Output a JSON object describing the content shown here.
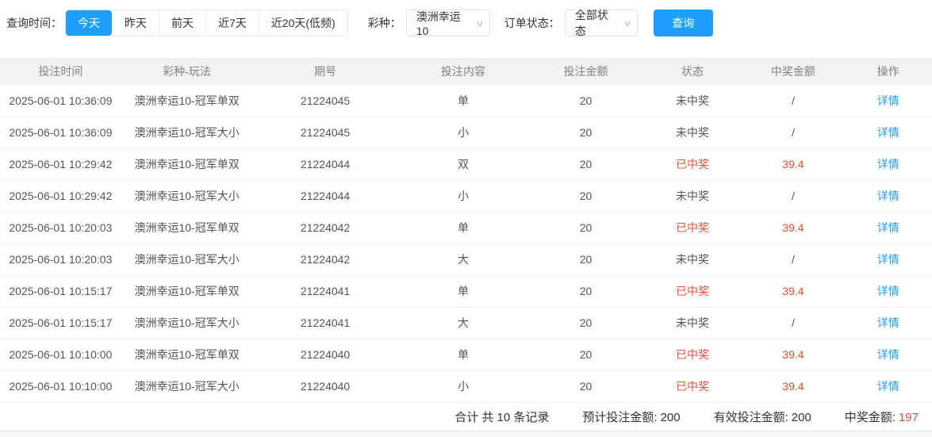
{
  "colors": {
    "accent": "#1e9fff",
    "danger": "#e74c3c"
  },
  "filters": {
    "time_label": "查询时间：",
    "time_options": [
      {
        "label": "今天",
        "active": true
      },
      {
        "label": "昨天",
        "active": false
      },
      {
        "label": "前天",
        "active": false
      },
      {
        "label": "近7天",
        "active": false
      },
      {
        "label": "近20天(低频)",
        "active": false
      }
    ],
    "lottery_label": "彩种：",
    "lottery_selected": "澳洲幸运10",
    "status_label": "订单状态：",
    "status_selected": "全部状态",
    "search_button": "查询",
    "chevron_icon": "∨"
  },
  "table": {
    "columns": [
      "投注时间",
      "彩种-玩法",
      "期号",
      "投注内容",
      "投注金额",
      "状态",
      "中奖金额",
      "操作"
    ],
    "action_label": "详情",
    "rows": [
      {
        "time": "2025-06-01 10:36:09",
        "game": "澳洲幸运10-冠军单双",
        "issue": "21224045",
        "content": "单",
        "amount": "20",
        "status": "未中奖",
        "prize": "/",
        "won": false
      },
      {
        "time": "2025-06-01 10:36:09",
        "game": "澳洲幸运10-冠军大小",
        "issue": "21224045",
        "content": "小",
        "amount": "20",
        "status": "未中奖",
        "prize": "/",
        "won": false
      },
      {
        "time": "2025-06-01 10:29:42",
        "game": "澳洲幸运10-冠军单双",
        "issue": "21224044",
        "content": "双",
        "amount": "20",
        "status": "已中奖",
        "prize": "39.4",
        "won": true
      },
      {
        "time": "2025-06-01 10:29:42",
        "game": "澳洲幸运10-冠军大小",
        "issue": "21224044",
        "content": "小",
        "amount": "20",
        "status": "未中奖",
        "prize": "/",
        "won": false
      },
      {
        "time": "2025-06-01 10:20:03",
        "game": "澳洲幸运10-冠军单双",
        "issue": "21224042",
        "content": "单",
        "amount": "20",
        "status": "已中奖",
        "prize": "39.4",
        "won": true
      },
      {
        "time": "2025-06-01 10:20:03",
        "game": "澳洲幸运10-冠军大小",
        "issue": "21224042",
        "content": "大",
        "amount": "20",
        "status": "未中奖",
        "prize": "/",
        "won": false
      },
      {
        "time": "2025-06-01 10:15:17",
        "game": "澳洲幸运10-冠军单双",
        "issue": "21224041",
        "content": "单",
        "amount": "20",
        "status": "已中奖",
        "prize": "39.4",
        "won": true
      },
      {
        "time": "2025-06-01 10:15:17",
        "game": "澳洲幸运10-冠军大小",
        "issue": "21224041",
        "content": "大",
        "amount": "20",
        "status": "未中奖",
        "prize": "/",
        "won": false
      },
      {
        "time": "2025-06-01 10:10:00",
        "game": "澳洲幸运10-冠军单双",
        "issue": "21224040",
        "content": "单",
        "amount": "20",
        "status": "已中奖",
        "prize": "39.4",
        "won": true
      },
      {
        "time": "2025-06-01 10:10:00",
        "game": "澳洲幸运10-冠军大小",
        "issue": "21224040",
        "content": "小",
        "amount": "20",
        "status": "已中奖",
        "prize": "39.4",
        "won": true
      }
    ]
  },
  "summary": {
    "total_records": "合计 共 10 条记录",
    "expected_label": "预计投注金额:",
    "expected_value": "200",
    "valid_label": "有效投注金额:",
    "valid_value": "200",
    "prize_label": "中奖金额:",
    "prize_value": "197"
  }
}
